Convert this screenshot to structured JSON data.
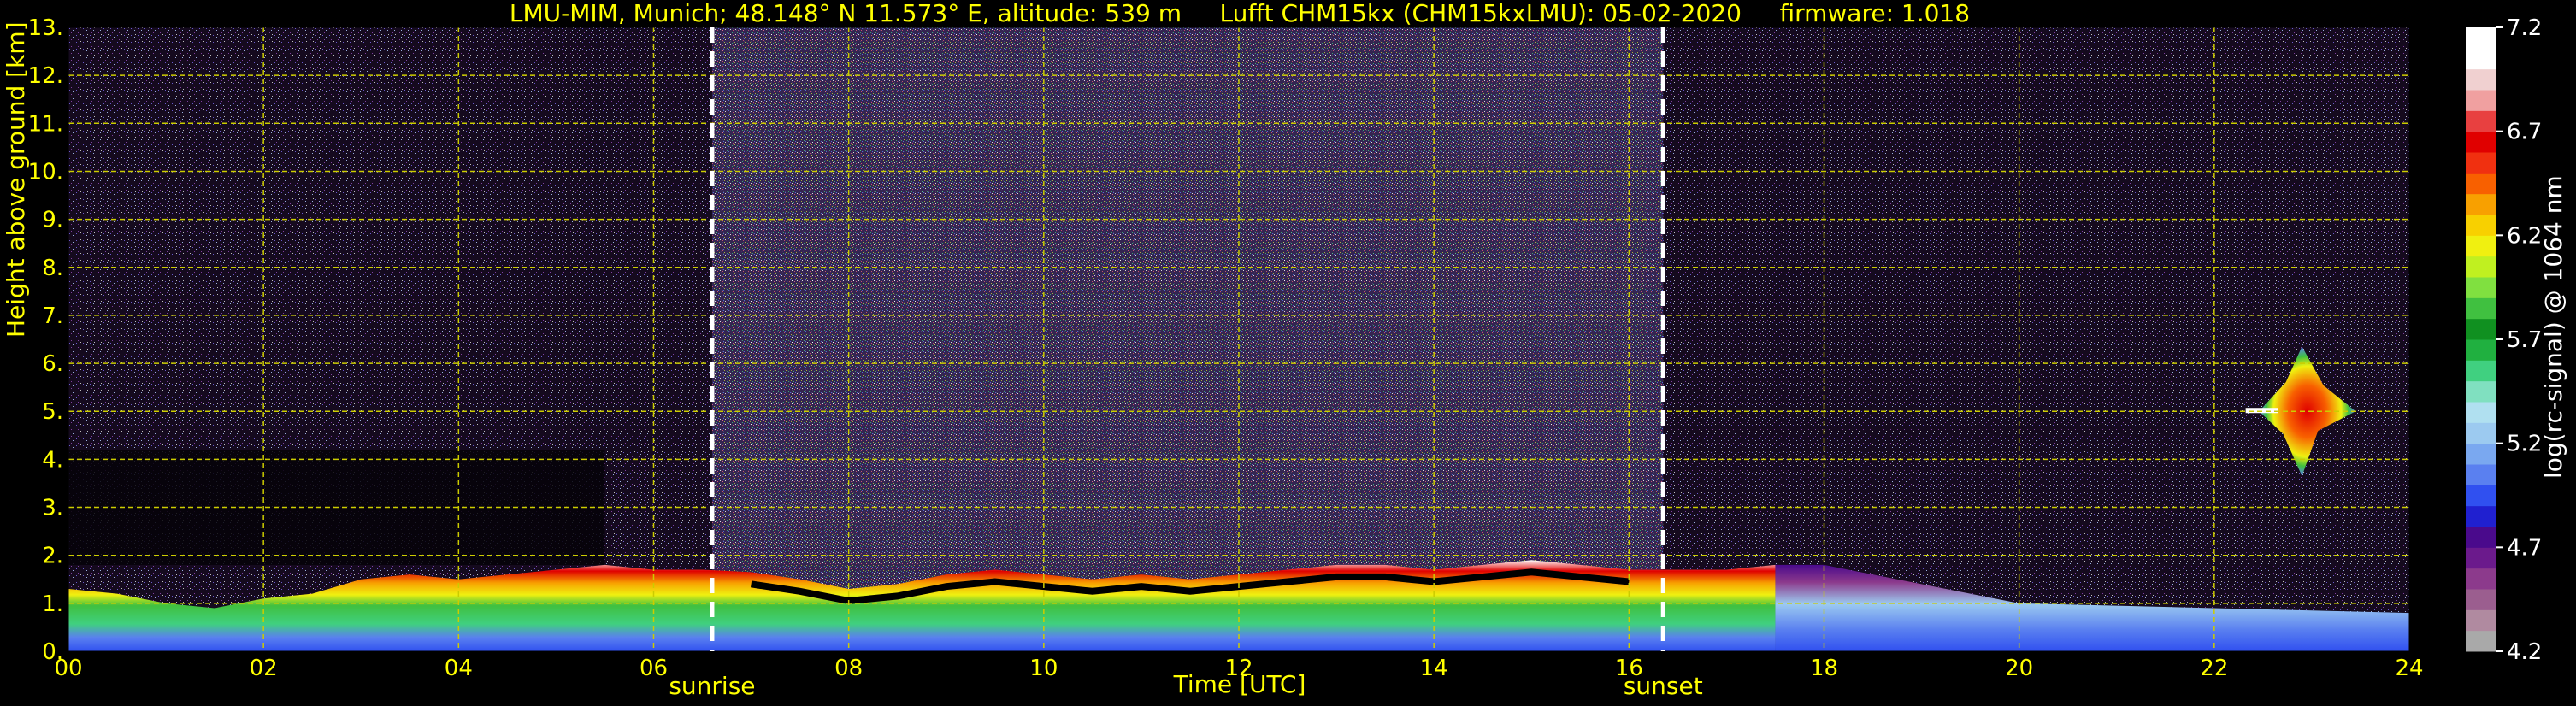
{
  "title": "LMU-MIM, Munich; 48.148° N 11.573° E, altitude: 539 m     Lufft CHM15kx (CHM15kxLMU): 05-02-2020     firmware: 1.018",
  "chart_data": {
    "type": "heatmap",
    "xlabel": "Time [UTC]",
    "ylabel": "Height above ground [km]",
    "xlim": [
      0,
      24
    ],
    "ylim": [
      0,
      13
    ],
    "x_ticks": [
      "00",
      "02",
      "04",
      "06",
      "08",
      "10",
      "12",
      "14",
      "16",
      "18",
      "20",
      "22",
      "24"
    ],
    "y_ticks": [
      "0.",
      "1.",
      "2.",
      "3.",
      "4.",
      "5.",
      "6.",
      "7.",
      "8.",
      "9.",
      "10.",
      "11.",
      "12.",
      "13."
    ],
    "grid": true,
    "annotations": [
      {
        "label": "sunrise",
        "x": 6.6
      },
      {
        "label": "sunset",
        "x": 16.35
      }
    ],
    "colorbar": {
      "label": "log(rc-signal) @ 1064 nm",
      "ticks": [
        "4.2",
        "4.7",
        "5.2",
        "5.7",
        "6.2",
        "6.7",
        "7.2"
      ],
      "range": [
        4.2,
        7.2
      ],
      "colors": [
        "#a9a9a9",
        "#b08aa0",
        "#9b5e8f",
        "#8c3a8c",
        "#6b1a8c",
        "#4a0a8c",
        "#2020d0",
        "#3050f0",
        "#5a80f0",
        "#7aa8f0",
        "#9ccaf0",
        "#b0e0f0",
        "#80e0c0",
        "#40d080",
        "#20b040",
        "#109020",
        "#40c040",
        "#80e040",
        "#c0f020",
        "#f0f010",
        "#f8d000",
        "#f8a000",
        "#f86000",
        "#f03010",
        "#e00000",
        "#e84040",
        "#f0a0a0",
        "#f0d0d0",
        "#ffffff",
        "#ffffff"
      ]
    },
    "features": {
      "boundary_layer": [
        [
          0,
          1.3
        ],
        [
          0.5,
          1.2
        ],
        [
          1,
          1.0
        ],
        [
          1.5,
          0.9
        ],
        [
          2,
          1.1
        ],
        [
          2.5,
          1.2
        ],
        [
          3,
          1.5
        ],
        [
          3.5,
          1.6
        ],
        [
          4,
          1.5
        ],
        [
          4.5,
          1.6
        ],
        [
          5,
          1.7
        ],
        [
          5.5,
          1.8
        ],
        [
          6,
          1.7
        ],
        [
          6.5,
          1.7
        ],
        [
          7,
          1.65
        ],
        [
          7.5,
          1.5
        ],
        [
          8,
          1.3
        ],
        [
          8.5,
          1.4
        ],
        [
          9,
          1.6
        ],
        [
          9.5,
          1.7
        ],
        [
          10,
          1.6
        ],
        [
          10.5,
          1.5
        ],
        [
          11,
          1.6
        ],
        [
          11.5,
          1.5
        ],
        [
          12,
          1.6
        ],
        [
          12.5,
          1.7
        ],
        [
          13,
          1.8
        ],
        [
          13.5,
          1.8
        ],
        [
          14,
          1.7
        ],
        [
          14.5,
          1.8
        ],
        [
          15,
          1.9
        ],
        [
          15.5,
          1.8
        ],
        [
          16,
          1.7
        ],
        [
          16.5,
          1.7
        ],
        [
          17,
          1.7
        ],
        [
          17.5,
          1.8
        ],
        [
          18,
          1.8
        ],
        [
          18.5,
          1.6
        ],
        [
          19,
          1.4
        ],
        [
          19.5,
          1.2
        ],
        [
          20,
          1.0
        ],
        [
          21,
          0.95
        ],
        [
          22,
          0.9
        ],
        [
          23,
          0.85
        ],
        [
          24,
          0.8
        ]
      ],
      "cloud": {
        "x": 22.9,
        "y": 5.0,
        "width_h": 1.1,
        "height_km": 2.7
      }
    }
  }
}
